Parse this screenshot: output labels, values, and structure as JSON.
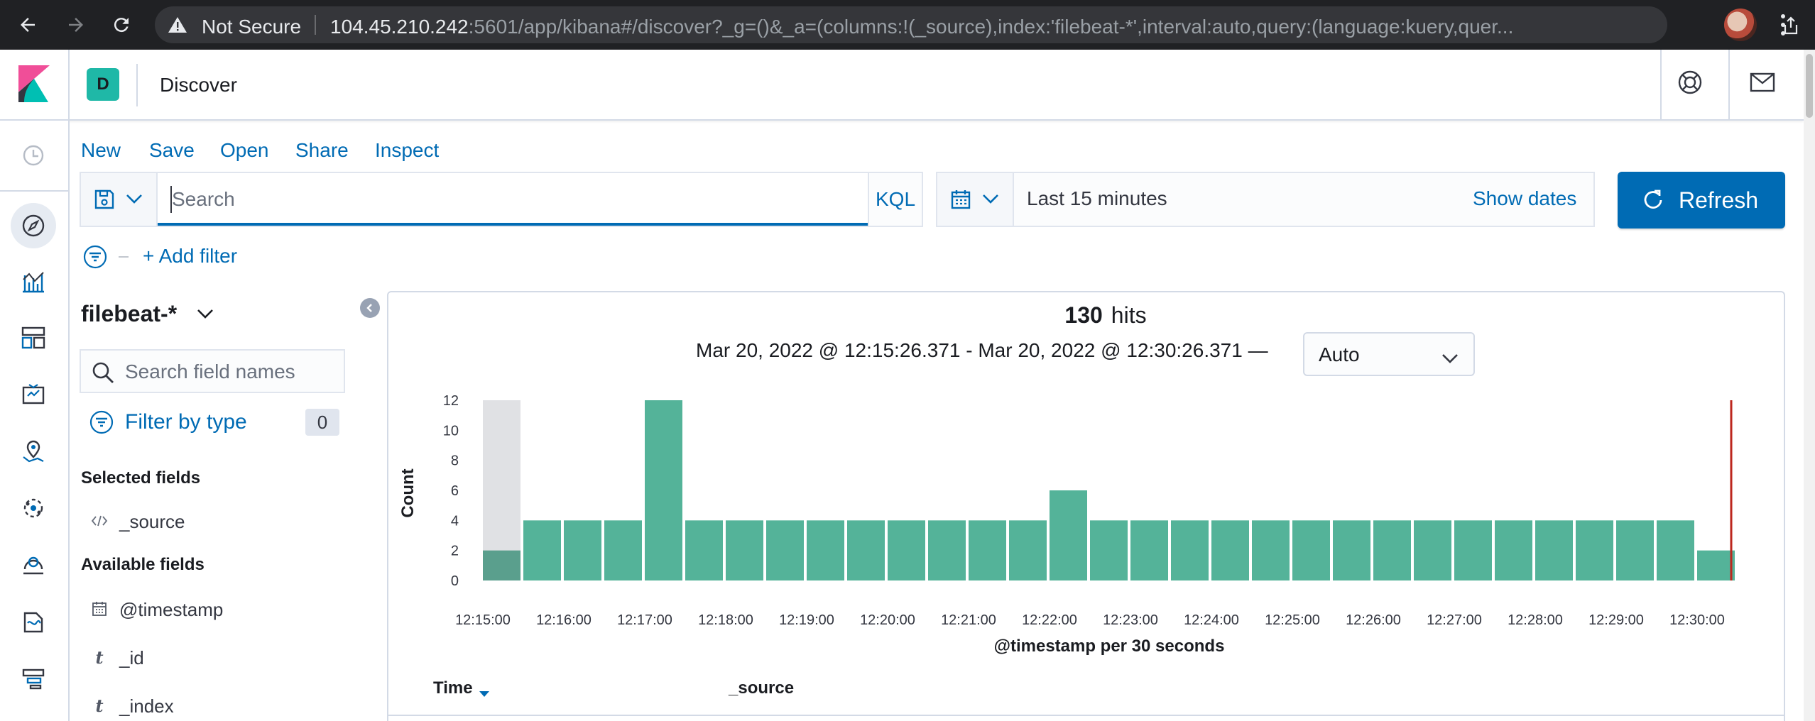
{
  "browser": {
    "security_label": "Not Secure",
    "url_host": "104.45.210.242",
    "url_rest": ":5601/app/kibana#/discover?_g=()&_a=(columns:!(_source),index:'filebeat-*',interval:auto,query:(language:kuery,quer..."
  },
  "header": {
    "space_initial": "D",
    "breadcrumb": "Discover"
  },
  "top_menu": [
    "New",
    "Save",
    "Open",
    "Share",
    "Inspect"
  ],
  "query_bar": {
    "placeholder": "Search",
    "language_label": "KQL",
    "time_range": "Last 15 minutes",
    "show_dates": "Show dates",
    "refresh_label": "Refresh"
  },
  "filter": {
    "add_label": "+ Add filter"
  },
  "sidebar": {
    "index_pattern": "filebeat-*",
    "field_search_placeholder": "Search field names",
    "filter_by_type": "Filter by type",
    "filter_count": "0",
    "selected_heading": "Selected fields",
    "selected_fields": [
      {
        "type": "source",
        "name": "_source"
      }
    ],
    "available_heading": "Available fields",
    "available_fields": [
      {
        "type": "date",
        "name": "@timestamp"
      },
      {
        "type": "string",
        "name": "_id",
        "glyph": "t"
      },
      {
        "type": "string",
        "name": "_index",
        "glyph": "t"
      }
    ]
  },
  "results": {
    "hits_count": "130",
    "hits_label": "hits",
    "range_text": "Mar 20, 2022 @ 12:15:26.371 - Mar 20, 2022 @ 12:30:26.371 —",
    "interval_value": "Auto",
    "columns": [
      "Time",
      "_source"
    ]
  },
  "chart_data": {
    "type": "bar",
    "xlabel": "@timestamp per 30 seconds",
    "ylabel": "Count",
    "ylim": [
      0,
      12
    ],
    "yticks": [
      0,
      2,
      4,
      6,
      8,
      10,
      12
    ],
    "xticks": [
      "12:15:00",
      "12:16:00",
      "12:17:00",
      "12:18:00",
      "12:19:00",
      "12:20:00",
      "12:21:00",
      "12:22:00",
      "12:23:00",
      "12:24:00",
      "12:25:00",
      "12:26:00",
      "12:27:00",
      "12:28:00",
      "12:29:00",
      "12:30:00"
    ],
    "x": [
      "12:15:00",
      "12:15:30",
      "12:16:00",
      "12:16:30",
      "12:17:00",
      "12:17:30",
      "12:18:00",
      "12:18:30",
      "12:19:00",
      "12:19:30",
      "12:20:00",
      "12:20:30",
      "12:21:00",
      "12:21:30",
      "12:22:00",
      "12:22:30",
      "12:23:00",
      "12:23:30",
      "12:24:00",
      "12:24:30",
      "12:25:00",
      "12:25:30",
      "12:26:00",
      "12:26:30",
      "12:27:00",
      "12:27:30",
      "12:28:00",
      "12:28:30",
      "12:29:00",
      "12:29:30",
      "12:30:00"
    ],
    "values": [
      2,
      4,
      4,
      4,
      12,
      4,
      4,
      4,
      4,
      4,
      4,
      4,
      4,
      4,
      6,
      4,
      4,
      4,
      4,
      4,
      4,
      4,
      4,
      4,
      4,
      4,
      4,
      4,
      4,
      4,
      2
    ],
    "bar_color": "#54b399",
    "partial_bucket_color": "#e0e1e4",
    "now_marker_color": "#bd271e",
    "grid": false
  }
}
